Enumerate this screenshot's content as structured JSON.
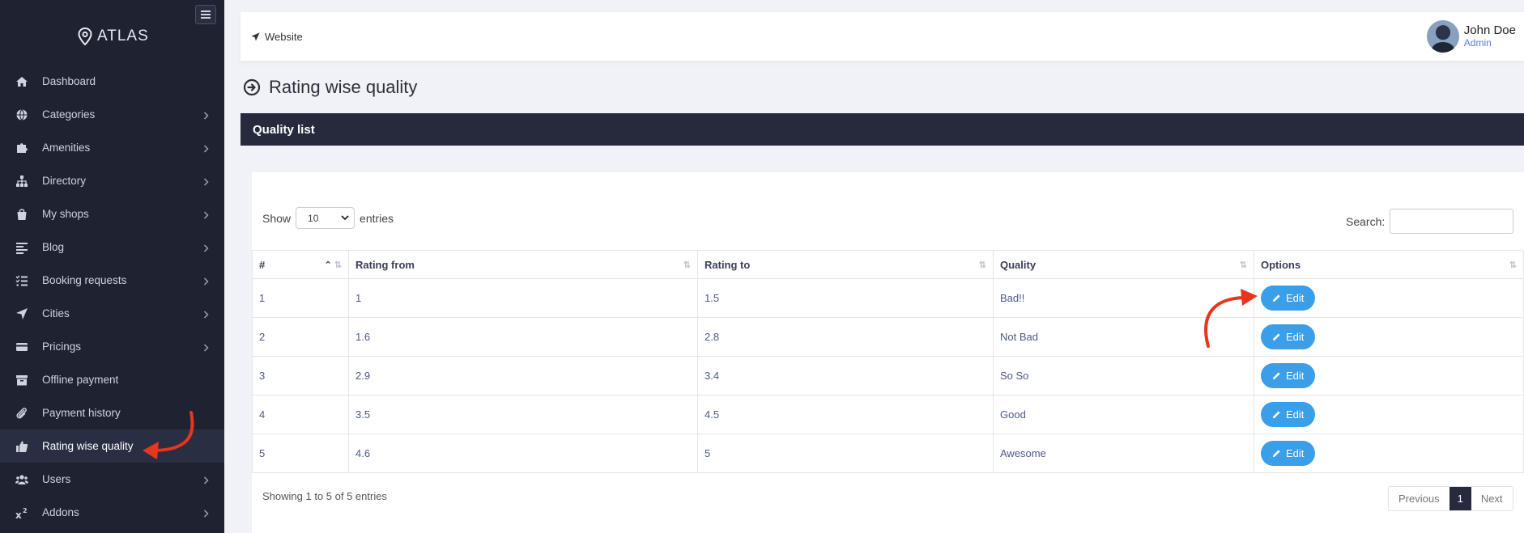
{
  "app": {
    "brand": "ATLAS"
  },
  "sidebar": {
    "items": [
      {
        "label": "Dashboard",
        "icon": "home-icon",
        "chevron": false
      },
      {
        "label": "Categories",
        "icon": "globe-icon",
        "chevron": true
      },
      {
        "label": "Amenities",
        "icon": "puzzle-icon",
        "chevron": true
      },
      {
        "label": "Directory",
        "icon": "sitemap-icon",
        "chevron": true
      },
      {
        "label": "My shops",
        "icon": "shopping-bag-icon",
        "chevron": true
      },
      {
        "label": "Blog",
        "icon": "align-left-icon",
        "chevron": true
      },
      {
        "label": "Booking requests",
        "icon": "tasks-icon",
        "chevron": true
      },
      {
        "label": "Cities",
        "icon": "location-arrow-icon",
        "chevron": true
      },
      {
        "label": "Pricings",
        "icon": "credit-card-icon",
        "chevron": true
      },
      {
        "label": "Offline payment",
        "icon": "archive-icon",
        "chevron": false
      },
      {
        "label": "Payment history",
        "icon": "paperclip-icon",
        "chevron": false
      },
      {
        "label": "Rating wise quality",
        "icon": "thumbs-up-icon",
        "chevron": false,
        "active": true
      },
      {
        "label": "Users",
        "icon": "users-icon",
        "chevron": true
      },
      {
        "label": "Addons",
        "icon": "superscript-icon",
        "chevron": true
      }
    ]
  },
  "topbar": {
    "website_label": "Website",
    "user_name": "John Doe",
    "user_role": "Admin"
  },
  "page": {
    "title": "Rating wise quality"
  },
  "card": {
    "title": "Quality list",
    "show_label": "Show",
    "entries_value": "10",
    "entries_label": "entries",
    "search_label": "Search:",
    "search_value": ""
  },
  "table": {
    "headers": [
      "#",
      "Rating from",
      "Rating to",
      "Quality",
      "Options"
    ],
    "rows": [
      {
        "num": "1",
        "from": "1",
        "to": "1.5",
        "quality": "Bad!!",
        "action": "Edit"
      },
      {
        "num": "2",
        "from": "1.6",
        "to": "2.8",
        "quality": "Not Bad",
        "action": "Edit"
      },
      {
        "num": "3",
        "from": "2.9",
        "to": "3.4",
        "quality": "So So",
        "action": "Edit"
      },
      {
        "num": "4",
        "from": "3.5",
        "to": "4.5",
        "quality": "Good",
        "action": "Edit"
      },
      {
        "num": "5",
        "from": "4.6",
        "to": "5",
        "quality": "Awesome",
        "action": "Edit"
      }
    ],
    "info": "Showing 1 to 5 of 5 entries"
  },
  "pagination": {
    "previous": "Previous",
    "current": "1",
    "next": "Next"
  },
  "colors": {
    "sidebar_bg": "#1f2231",
    "header_bg": "#272a3d",
    "button_blue": "#3a9ee8",
    "arrow_red": "#e8351f"
  }
}
